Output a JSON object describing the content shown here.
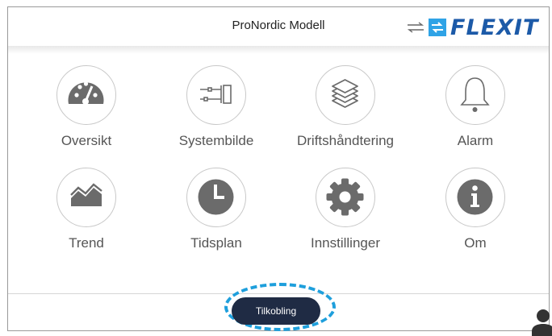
{
  "header": {
    "title": "ProNordic Modell",
    "brand": "FLEXIT",
    "brand_color": "#1c5aa8"
  },
  "menu": [
    {
      "label": "Oversikt",
      "icon": "gauge-icon"
    },
    {
      "label": "Systembilde",
      "icon": "system-diagram-icon"
    },
    {
      "label": "Driftshåndtering",
      "icon": "layers-icon"
    },
    {
      "label": "Alarm",
      "icon": "bell-icon"
    },
    {
      "label": "Trend",
      "icon": "trend-chart-icon"
    },
    {
      "label": "Tidsplan",
      "icon": "clock-icon"
    },
    {
      "label": "Innstillinger",
      "icon": "gear-icon"
    },
    {
      "label": "Om",
      "icon": "info-icon"
    }
  ],
  "footer": {
    "connect_label": "Tilkobling",
    "button_color": "#1f2b44",
    "highlight_color": "#1e9fdc"
  }
}
